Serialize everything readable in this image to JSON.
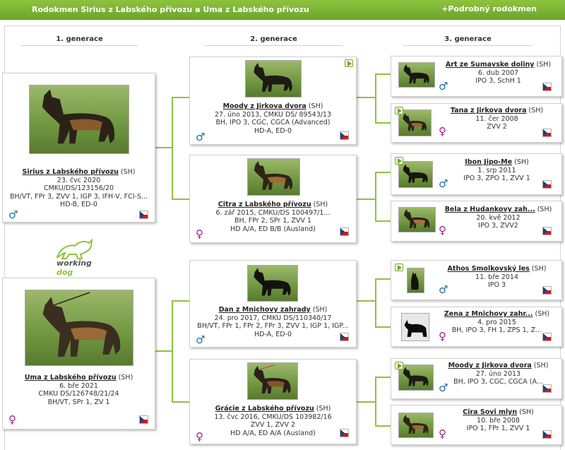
{
  "header": {
    "title": "Rodokmen Sirius z Labského přívozu a Uma z Labského přívozu",
    "detail_link": "+Podrobný rodokmen"
  },
  "generations": [
    "1. generace",
    "2. generace",
    "3. generace"
  ],
  "logo": {
    "part1": "working",
    "part2": "dog"
  },
  "colors": {
    "accent": "#8dc43e",
    "male": "#1a6fa8",
    "female": "#a0208f"
  },
  "gen1": [
    {
      "name": "Sirius z Labského přívozu",
      "breed": " (SH)",
      "sex": "♂",
      "lines": [
        "23. čvc 2020",
        "CMKU/DS/123156/20",
        "BH/VT, FPr 3, ZVV 1, IGP 3, IFH-V, FCI-S...",
        "HD-B, ED-0"
      ]
    },
    {
      "name": "Uma z Labského přívozu",
      "breed": " (SH)",
      "sex": "♀",
      "lines": [
        "6. bře 2021",
        "CMKU DS/126748/21/24",
        "BH/VT, SPr 1, ZV 1"
      ]
    }
  ],
  "gen2": [
    {
      "name": "Moody z Jirkova dvora",
      "breed": " (SH)",
      "sex": "♂",
      "lines": [
        "27. úno 2013, CMKU DS/ 89543/13",
        "BH, IPO 3, CGC, CGCA (Advanced)",
        "HD-A, ED-0"
      ]
    },
    {
      "name": "Citra z Labského přívozu",
      "breed": " (SH)",
      "sex": "♀",
      "lines": [
        "6. zář 2015, CMKU/DS 100497/1...",
        "BH, FPr 2, SPr 1, ZVV 1",
        "HD A/A, ED B/B (Ausland)"
      ]
    },
    {
      "name": "Dan z Mnichovy zahrady",
      "breed": " (SH)",
      "sex": "♂",
      "lines": [
        "24. pro 2017, CMKU DS/110340/17",
        "BH/VT, FPr 1, FPr 2, FPr 3, ZVV 1, IGP 1, IGP...",
        "HD-A, ED-0"
      ]
    },
    {
      "name": "Grácie z Labského přívozu",
      "breed": " (SH)",
      "sex": "♀",
      "lines": [
        "13. čvc 2016, CMKU/DS 103982/16",
        "ZVV 1, ZVV 2",
        "HD A/A, ED A/A (Ausland)"
      ]
    }
  ],
  "gen3": [
    {
      "name": "Art ze Sumavske doliny",
      "breed": " (SH)",
      "sex": "♂",
      "lines": [
        "6. dub 2007",
        "IPO 3, SchH 1"
      ]
    },
    {
      "name": "Tana z Jirkova dvora",
      "breed": " (SH)",
      "sex": "♀",
      "lines": [
        "11. čer 2008",
        "ZVV 2"
      ]
    },
    {
      "name": "Ibon Jipo-Me",
      "breed": " (SH)",
      "sex": "♂",
      "lines": [
        "1. srp 2011",
        "IPO 3, ZPO 1, ZVV 1"
      ]
    },
    {
      "name": "Bela z Hudankovy zah...",
      "breed": " (SH)",
      "sex": "♀",
      "lines": [
        "20. kvě 2012",
        "IPO 3, ZVV2"
      ]
    },
    {
      "name": "Athos Smolkovský les",
      "breed": " (SH)",
      "sex": "♂",
      "lines": [
        "11. bře 2014",
        "IPO 3"
      ]
    },
    {
      "name": "Zena z Mnichovy zahr...",
      "breed": " (SH)",
      "sex": "♀",
      "lines": [
        "4. pro 2015",
        "BH, IPO 3, FH 1, ZPS 1, Z..."
      ]
    },
    {
      "name": "Moody z Jirkova dvora",
      "breed": " (SH)",
      "sex": "♂",
      "lines": [
        "27. úno 2013",
        "BH, IPO 3, CGC, CGCA (A..."
      ]
    },
    {
      "name": "Cira Sovi mlyn",
      "breed": " (SH)",
      "sex": "♀",
      "lines": [
        "10. bře 2008",
        "IPO 1, FPr 1, ZVV 1"
      ]
    }
  ]
}
